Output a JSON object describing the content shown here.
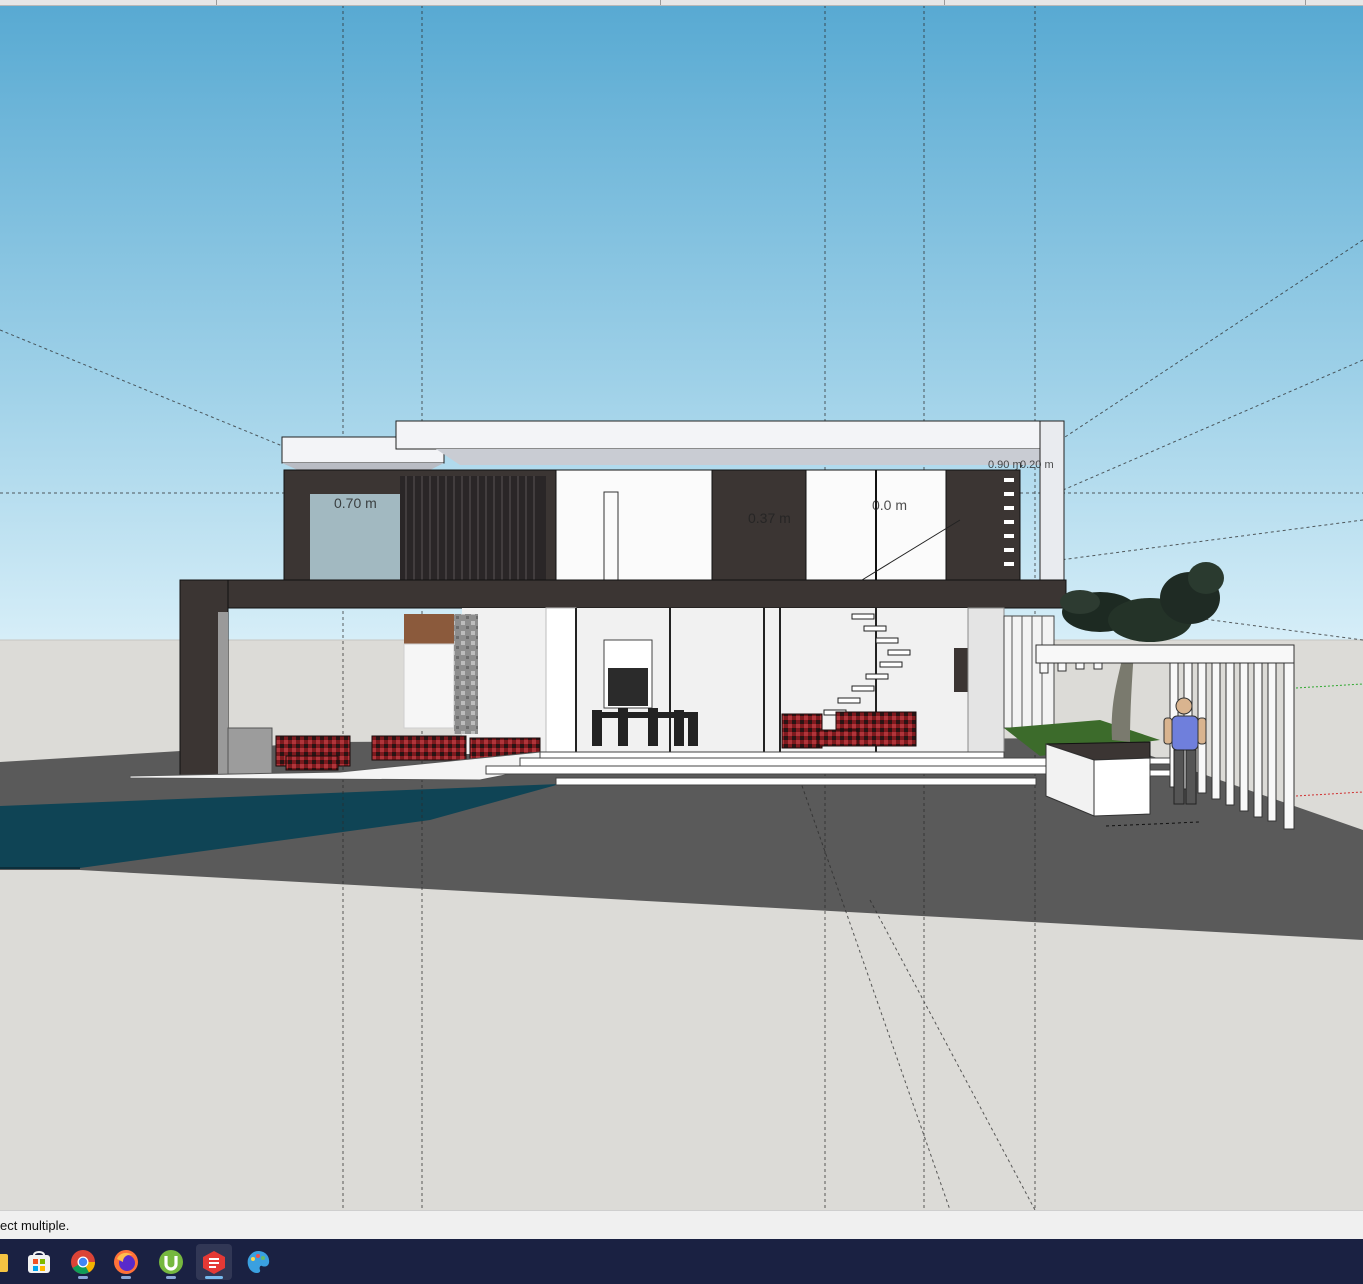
{
  "status": {
    "text": "ect multiple."
  },
  "scene": {
    "dimension_labels": [
      "0.70 m",
      "0.37 m",
      "0.0 m",
      "0.90 m",
      "0.20 m"
    ],
    "colors": {
      "sky_top": "#57a9d2",
      "sky_bottom": "#d6eef8",
      "ground": "#dcdbd7",
      "terrain": "#5a5a5a",
      "pool": "#0f4455",
      "facade_dark": "#3b3533",
      "slab_white": "#f3f4f7",
      "wood": "#8b5a3c",
      "sofa_red": "#8a1e22"
    }
  },
  "taskbar": {
    "icons": [
      {
        "name": "file-explorer-icon",
        "label": "File Explorer"
      },
      {
        "name": "microsoft-store-icon",
        "label": "Microsoft Store"
      },
      {
        "name": "chrome-icon",
        "label": "Google Chrome"
      },
      {
        "name": "firefox-icon",
        "label": "Firefox"
      },
      {
        "name": "utorrent-icon",
        "label": "uTorrent"
      },
      {
        "name": "sketchup-icon",
        "label": "SketchUp"
      },
      {
        "name": "paint-icon",
        "label": "Paint"
      }
    ]
  }
}
